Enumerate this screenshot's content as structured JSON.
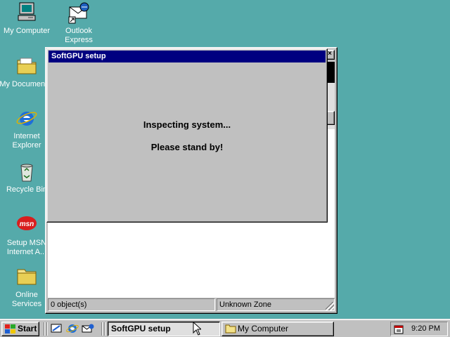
{
  "desktop": {
    "background": "#55aaaa",
    "icons": [
      {
        "label": "My Computer",
        "icon": "my-computer-icon"
      },
      {
        "label": "Outlook Express",
        "icon": "outlook-express-icon"
      },
      {
        "label": "My Documents",
        "icon": "folder-icon"
      },
      {
        "label": "Internet Explorer",
        "icon": "internet-explorer-icon"
      },
      {
        "label": "Recycle Bin",
        "icon": "recycle-bin-icon"
      },
      {
        "label": "Setup MSN Internet A...",
        "icon": "msn-icon"
      },
      {
        "label": "Online Services",
        "icon": "folder-icon"
      }
    ]
  },
  "explorer_window": {
    "status_objects": "0 object(s)",
    "status_zone": "Unknown Zone",
    "close_glyph": "×"
  },
  "setup_dialog": {
    "title": "SoftGPU setup",
    "line1": "Inspecting system...",
    "line2": "Please stand by!",
    "titlebar_color": "#000080"
  },
  "taskbar": {
    "start_label": "Start",
    "quick_launch": [
      "show-desktop-icon",
      "internet-explorer-icon",
      "outlook-express-icon"
    ],
    "tasks": [
      {
        "label": "SoftGPU setup",
        "active": true
      },
      {
        "label": "My Computer",
        "active": false
      }
    ],
    "clock": "9:20 PM"
  }
}
